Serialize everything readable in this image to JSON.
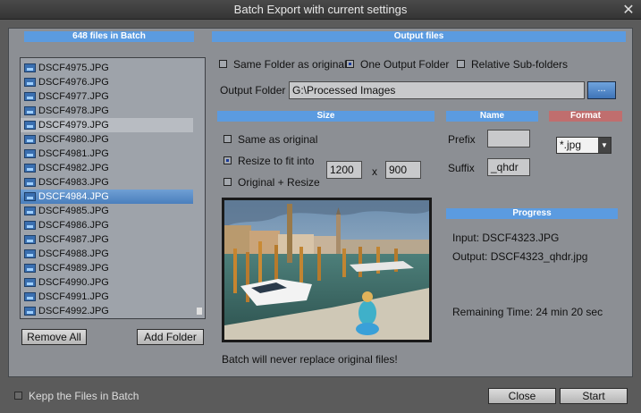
{
  "window": {
    "title": "Batch Export with current settings",
    "close_glyph": "✕"
  },
  "batch": {
    "header": "648 files in Batch",
    "files": [
      "DSCF4975.JPG",
      "DSCF4976.JPG",
      "DSCF4977.JPG",
      "DSCF4978.JPG",
      "DSCF4979.JPG",
      "DSCF4980.JPG",
      "DSCF4981.JPG",
      "DSCF4982.JPG",
      "DSCF4983.JPG",
      "DSCF4984.JPG",
      "DSCF4985.JPG",
      "DSCF4986.JPG",
      "DSCF4987.JPG",
      "DSCF4988.JPG",
      "DSCF4989.JPG",
      "DSCF4990.JPG",
      "DSCF4991.JPG",
      "DSCF4992.JPG"
    ],
    "highlighted_file": "DSCF4979.JPG",
    "selected_file": "DSCF4984.JPG",
    "remove_all_label": "Remove All",
    "add_folder_label": "Add Folder"
  },
  "output": {
    "header": "Output files",
    "options": [
      "Same Folder as original",
      "One Output Folder",
      "Relative Sub-folders"
    ],
    "selected_option": "One Output Folder",
    "folder_label": "Output Folder",
    "folder_value": "G:\\Processed Images",
    "browse_label": "..."
  },
  "size": {
    "header": "Size",
    "options": [
      "Same as original",
      "Resize to fit into",
      "Original + Resize"
    ],
    "selected_option": "Resize to fit into",
    "width": "1200",
    "separator": "x",
    "height": "900"
  },
  "name": {
    "header": "Name",
    "prefix_label": "Prefix",
    "prefix_value": "",
    "suffix_label": "Suffix",
    "suffix_value": "_qhdr"
  },
  "format": {
    "header": "Format",
    "value": "*.jpg"
  },
  "progress": {
    "header": "Progress",
    "input_text": "Input: DSCF4323.JPG",
    "output_text": "Output: DSCF4323_qhdr.jpg",
    "remaining_text": "Remaining Time: 24 min 20 sec"
  },
  "notice": "Batch will never replace original files!",
  "footer": {
    "keep_label": "Kepp the Files in Batch",
    "keep_checked": false,
    "close_label": "Close",
    "start_label": "Start"
  },
  "colors": {
    "section_header": "#5b9be0",
    "format_header": "#c06e6e",
    "selection": "#4a7fbd"
  },
  "icons": {
    "file": "image-file-icon",
    "close": "close-icon",
    "dropdown": "chevron-down-icon"
  }
}
